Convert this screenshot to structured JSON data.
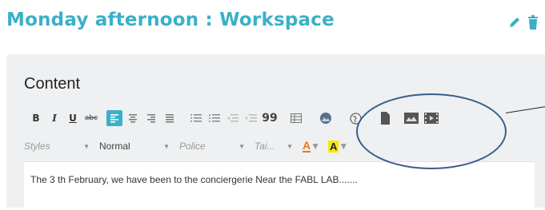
{
  "header": {
    "title": "Monday afternoon : Workspace",
    "icons": [
      "pencil-icon",
      "trash-icon"
    ],
    "accent_color": "#3ab0c8"
  },
  "content_section": {
    "label": "Content"
  },
  "toolbar_row1": {
    "bold": "B",
    "italic": "I",
    "underline": "U",
    "strikethrough": "abc",
    "quote": "99",
    "align_left_active": true
  },
  "toolbar_row2": {
    "styles": "Styles",
    "format": "Normal",
    "font": "Police",
    "size": "Tai...",
    "text_color_glyph": "A",
    "bg_color_glyph": "A"
  },
  "editor": {
    "text": "The 3 th February, we have been to the conciergerie Near the FABL LAB......."
  },
  "highlight_colors": {
    "oval": "#3a5d8c",
    "bg_color_highlight": "#f5e90d",
    "text_color_orange": "#e87a17"
  }
}
